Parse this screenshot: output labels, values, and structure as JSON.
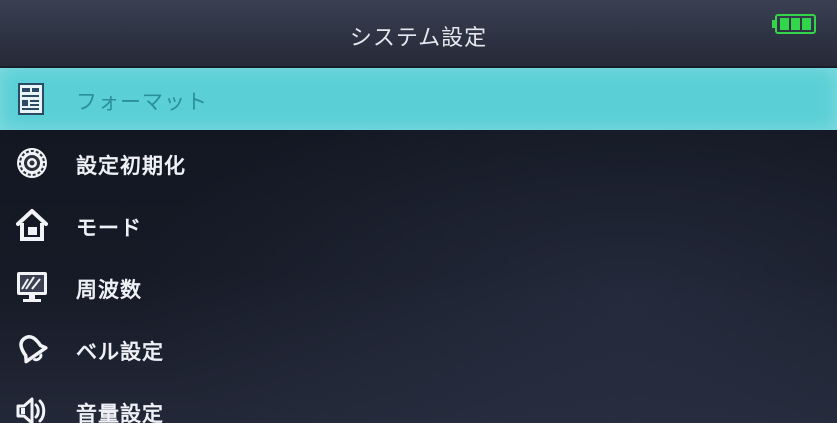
{
  "header": {
    "title": "システム設定",
    "battery_icon": "battery-full-icon",
    "battery_color": "#33d64a"
  },
  "menu": {
    "selected_color": "#5ad0d6",
    "items": [
      {
        "label": "フォーマット",
        "icon": "format-document-icon",
        "selected": true
      },
      {
        "label": "設定初期化",
        "icon": "reset-dial-icon",
        "selected": false
      },
      {
        "label": "モード",
        "icon": "home-mode-icon",
        "selected": false
      },
      {
        "label": "周波数",
        "icon": "frequency-monitor-icon",
        "selected": false
      },
      {
        "label": "ベル設定",
        "icon": "bell-icon",
        "selected": false
      },
      {
        "label": "音量設定",
        "icon": "speaker-volume-icon",
        "selected": false
      }
    ]
  }
}
